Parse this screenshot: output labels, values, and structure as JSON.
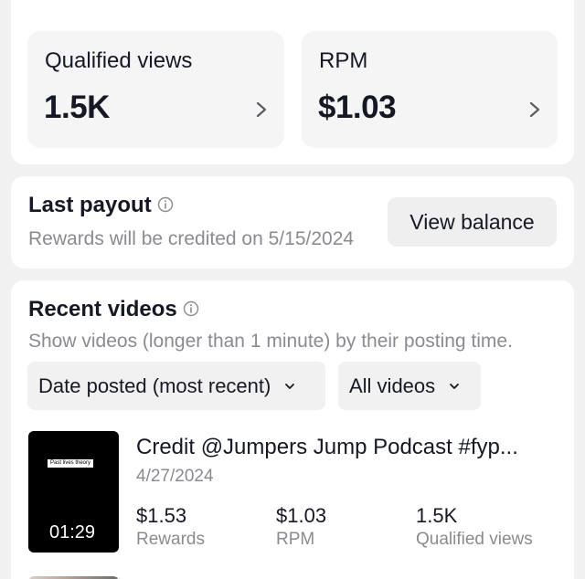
{
  "stats": [
    {
      "label": "Qualified views",
      "value": "1.5K"
    },
    {
      "label": "RPM",
      "value": "$1.03"
    }
  ],
  "payout": {
    "title": "Last payout",
    "subtitle": "Rewards will be credited on 5/15/2024",
    "button_label": "View balance"
  },
  "recent": {
    "title": "Recent videos",
    "subtitle": "Show videos (longer than 1 minute) by their posting time.",
    "filters": [
      {
        "label": "Date posted (most recent)"
      },
      {
        "label": "All videos"
      }
    ],
    "videos": [
      {
        "thumb_caption": "Past lives theory",
        "duration": "01:29",
        "title": "Credit @Jumpers Jump Podcast #fyp...",
        "date": "4/27/2024",
        "metrics": [
          {
            "value": "$1.53",
            "label": "Rewards"
          },
          {
            "value": "$1.03",
            "label": "RPM"
          },
          {
            "value": "1.5K",
            "label": "Qualified views"
          }
        ]
      }
    ]
  },
  "icons": {
    "chevron": "chevron-right-icon",
    "info": "info-icon",
    "dropdown": "chevron-down-icon"
  },
  "colors": {
    "background": "#f1f1f2",
    "card": "#ffffff",
    "text": "#161823",
    "secondary_text": "#8a8b91"
  }
}
